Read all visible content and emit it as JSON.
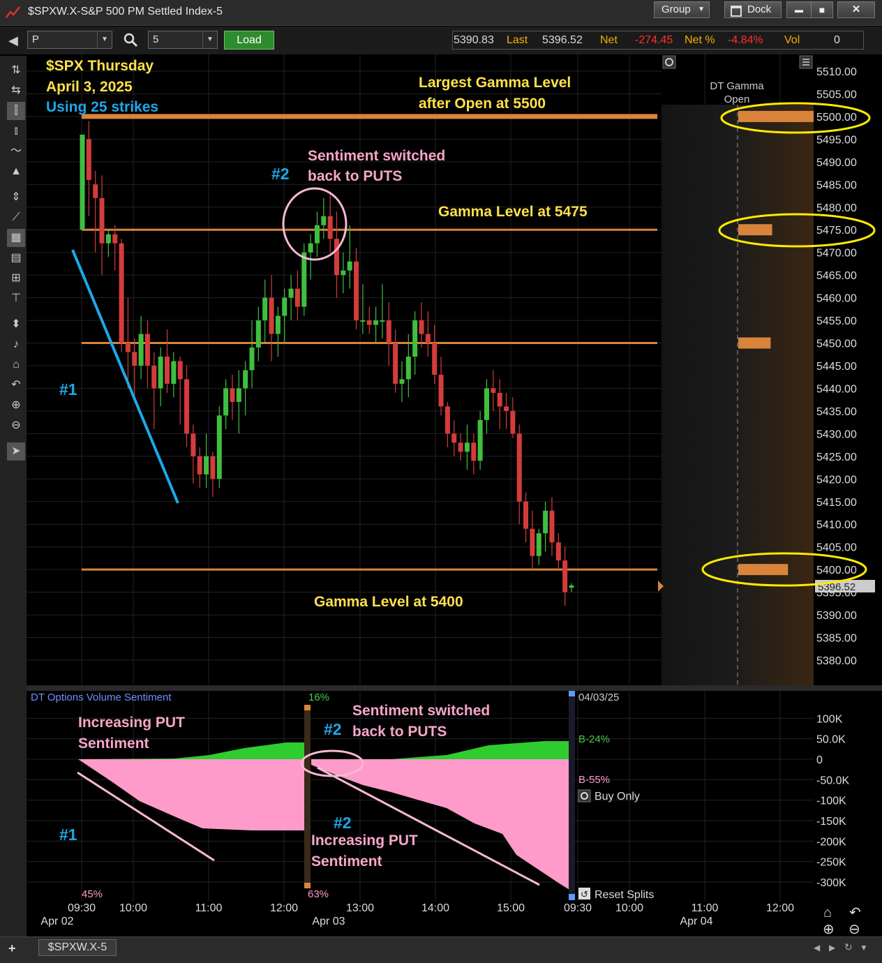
{
  "window": {
    "title": "$SPXW.X-S&P 500 PM Settled Index-5",
    "group_label": "Group",
    "dock_label": "Dock",
    "minimize": "▬",
    "maximize": "■",
    "close": "✕"
  },
  "toolbar": {
    "symbol_value": "P",
    "interval_value": "5",
    "load_label": "Load",
    "prev_value": "5390.83",
    "last_label": "Last",
    "last_value": "5396.52",
    "net_label": "Net",
    "net_value": "-274.45",
    "netpct_label": "Net %",
    "netpct_value": "-4.84%",
    "vol_label": "Vol",
    "vol_value": "0"
  },
  "colors": {
    "up": "#3fbf3f",
    "down": "#d43c3c",
    "gamma_line": "#d9843a",
    "yellow_text": "#ffe14a",
    "blue_text": "#1ea7e8",
    "pink_text": "#f7a6c8",
    "sentiment_pink": "#ff9bcb",
    "sentiment_green": "#2ecc2e",
    "price_tag": "#cccccc",
    "net_red": "#ff3030"
  },
  "annotations": {
    "heading_line1": "$SPX Thursday",
    "heading_line2": "April 3, 2025",
    "heading_line3": "Using 25 strikes",
    "largest_line1": "Largest Gamma Level",
    "largest_line2": "after Open at 5500",
    "sentiment_line1": "Sentiment switched",
    "sentiment_line2": "back to PUTS",
    "label_2": "#2",
    "gamma_5475": "Gamma Level at 5475",
    "label_1": "#1",
    "gamma_5400": "Gamma Level at 5400",
    "lower_increasing_line1": "Increasing PUT",
    "lower_increasing_line2": "Sentiment",
    "lower_label_1": "#1",
    "lower_label_2a": "#2",
    "lower_sentiment_line1": "Sentiment switched",
    "lower_sentiment_line2": "back to PUTS",
    "lower_label_2b": "#2",
    "lower_increasing2_line1": "Increasing PUT",
    "lower_increasing2_line2": "Sentiment"
  },
  "gamma_panel": {
    "title_line1": "DT Gamma",
    "title_line2": "Open",
    "bars": [
      {
        "level": 5500,
        "strength": 1.0
      },
      {
        "level": 5475,
        "strength": 0.45
      },
      {
        "level": 5450,
        "strength": 0.43
      },
      {
        "level": 5400,
        "strength": 0.66
      }
    ]
  },
  "price_tag": "5396.52",
  "lower_panel": {
    "title": "DT Options Volume Sentiment",
    "pct_top": "16%",
    "pct_bottom_left": "45%",
    "pct_bottom_mid": "63%",
    "date_label": "04/03/25",
    "buy_pct": "B-24%",
    "sell_pct": "B-55%",
    "buy_only_label": "Buy Only",
    "reset_splits_label": "Reset Splits",
    "y_ticks": [
      "100K",
      "50.0K",
      "0",
      "-50.0K",
      "-100K",
      "-150K",
      "-200K",
      "-250K",
      "-300K"
    ]
  },
  "x_axis": {
    "times": [
      "09:30",
      "10:00",
      "11:00",
      "12:00",
      "13:00",
      "14:00",
      "15:00",
      "09:30",
      "10:00",
      "11:00",
      "12:00"
    ],
    "dates": [
      "Apr 02",
      "Apr 03",
      "Apr 04"
    ]
  },
  "bottom_tab": {
    "label": "$SPXW.X-5",
    "add": "+"
  },
  "chart_data": {
    "type": "candlestick",
    "title": "$SPXW.X-S&P 500 PM Settled Index-5",
    "interval_minutes": 5,
    "date": "2025-04-03",
    "ylim": [
      5375,
      5512
    ],
    "y_ticks": [
      5510,
      5505,
      5500,
      5495,
      5490,
      5485,
      5480,
      5475,
      5470,
      5465,
      5460,
      5455,
      5450,
      5445,
      5440,
      5435,
      5430,
      5425,
      5420,
      5415,
      5410,
      5405,
      5400,
      5395,
      5390,
      5385,
      5380
    ],
    "gamma_levels": [
      5500,
      5475,
      5450,
      5400
    ],
    "last": 5396.52,
    "candles": [
      [
        5475,
        5495,
        5476,
        5496
      ],
      [
        5495,
        5499,
        5478,
        5486
      ],
      [
        5485,
        5488,
        5470,
        5482
      ],
      [
        5482,
        5487,
        5465,
        5472
      ],
      [
        5472,
        5475,
        5469,
        5474
      ],
      [
        5474,
        5476,
        5466,
        5472
      ],
      [
        5472,
        5473,
        5448,
        5450
      ],
      [
        5450,
        5460,
        5440,
        5448
      ],
      [
        5448,
        5451,
        5437,
        5445
      ],
      [
        5445,
        5456,
        5442,
        5452
      ],
      [
        5452,
        5455,
        5440,
        5445
      ],
      [
        5445,
        5448,
        5431,
        5440
      ],
      [
        5440,
        5449,
        5436,
        5447
      ],
      [
        5447,
        5453,
        5439,
        5441
      ],
      [
        5441,
        5448,
        5438,
        5446
      ],
      [
        5446,
        5447,
        5432,
        5442
      ],
      [
        5442,
        5445,
        5427,
        5430
      ],
      [
        5430,
        5432,
        5419,
        5425
      ],
      [
        5425,
        5427,
        5418,
        5421
      ],
      [
        5421,
        5430,
        5418,
        5425
      ],
      [
        5425,
        5426,
        5416,
        5420
      ],
      [
        5420,
        5436,
        5418,
        5434
      ],
      [
        5434,
        5442,
        5431,
        5440
      ],
      [
        5440,
        5443,
        5433,
        5437
      ],
      [
        5437,
        5444,
        5430,
        5440
      ],
      [
        5440,
        5446,
        5434,
        5444
      ],
      [
        5444,
        5455,
        5440,
        5449
      ],
      [
        5449,
        5458,
        5446,
        5455
      ],
      [
        5455,
        5464,
        5450,
        5460
      ],
      [
        5460,
        5465,
        5446,
        5452
      ],
      [
        5452,
        5458,
        5447,
        5456
      ],
      [
        5456,
        5462,
        5450,
        5460
      ],
      [
        5460,
        5465,
        5455,
        5462
      ],
      [
        5462,
        5466,
        5455,
        5458
      ],
      [
        5458,
        5472,
        5456,
        5470
      ],
      [
        5470,
        5474,
        5464,
        5472
      ],
      [
        5472,
        5479,
        5469,
        5476
      ],
      [
        5476,
        5482,
        5473,
        5478
      ],
      [
        5478,
        5483,
        5470,
        5473
      ],
      [
        5473,
        5479,
        5460,
        5465
      ],
      [
        5465,
        5470,
        5461,
        5466
      ],
      [
        5466,
        5476,
        5462,
        5468
      ],
      [
        5468,
        5471,
        5453,
        5455
      ],
      [
        5455,
        5463,
        5452,
        5455
      ],
      [
        5455,
        5458,
        5452,
        5454
      ],
      [
        5454,
        5458,
        5450,
        5455
      ],
      [
        5455,
        5463,
        5451,
        5455
      ],
      [
        5455,
        5459,
        5445,
        5450
      ],
      [
        5450,
        5453,
        5439,
        5441
      ],
      [
        5441,
        5446,
        5437,
        5442
      ],
      [
        5442,
        5452,
        5438,
        5447
      ],
      [
        5447,
        5457,
        5443,
        5455
      ],
      [
        5455,
        5459,
        5449,
        5452
      ],
      [
        5452,
        5457,
        5447,
        5450
      ],
      [
        5450,
        5454,
        5441,
        5443
      ],
      [
        5443,
        5447,
        5434,
        5436
      ],
      [
        5436,
        5437,
        5427,
        5430
      ],
      [
        5430,
        5433,
        5425,
        5428
      ],
      [
        5428,
        5430,
        5424,
        5426
      ],
      [
        5426,
        5432,
        5422,
        5428
      ],
      [
        5428,
        5430,
        5421,
        5424
      ],
      [
        5424,
        5435,
        5422,
        5433
      ],
      [
        5433,
        5442,
        5430,
        5440
      ],
      [
        5440,
        5444,
        5435,
        5439
      ],
      [
        5439,
        5442,
        5431,
        5436
      ],
      [
        5436,
        5439,
        5431,
        5435
      ],
      [
        5435,
        5438,
        5429,
        5430
      ],
      [
        5430,
        5432,
        5410,
        5415
      ],
      [
        5415,
        5417,
        5406,
        5409
      ],
      [
        5409,
        5413,
        5400,
        5403
      ],
      [
        5403,
        5409,
        5401,
        5408
      ],
      [
        5408,
        5415,
        5404,
        5413
      ],
      [
        5413,
        5416,
        5403,
        5406
      ],
      [
        5406,
        5408,
        5400,
        5402
      ],
      [
        5402,
        5405,
        5392,
        5395
      ],
      [
        5396,
        5397,
        5395,
        5396.5
      ]
    ]
  }
}
